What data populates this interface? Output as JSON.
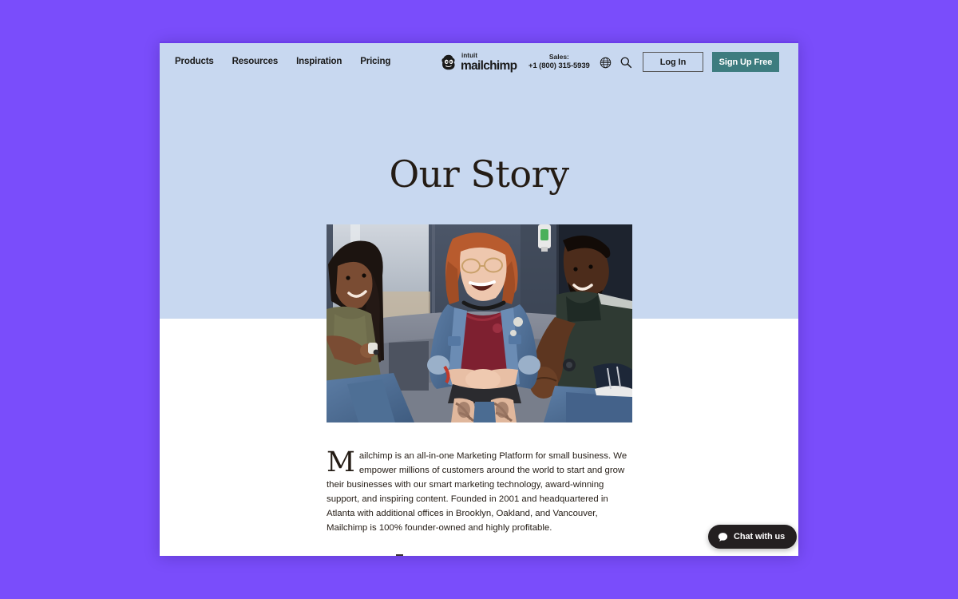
{
  "theme": {
    "page_backdrop": "#7a4dfb",
    "hero_background": "#c8d8f0",
    "accent_teal": "#3d7c7f",
    "text_dark": "#241c15",
    "chat_background": "#231f20"
  },
  "header": {
    "nav_links": [
      {
        "label": "Products",
        "name": "nav-link-products"
      },
      {
        "label": "Resources",
        "name": "nav-link-resources"
      },
      {
        "label": "Inspiration",
        "name": "nav-link-inspiration"
      },
      {
        "label": "Pricing",
        "name": "nav-link-pricing"
      }
    ],
    "brand": {
      "icon": "freddie-monkey-icon",
      "parent": "intuit",
      "name": "mailchimp"
    },
    "sales": {
      "label": "Sales:",
      "phone": "+1 (800) 315-5939"
    },
    "icons": {
      "globe": "globe-icon",
      "search": "search-icon"
    },
    "login_label": "Log In",
    "signup_label": "Sign Up Free"
  },
  "hero": {
    "title": "Our Story",
    "photo_alt": "Three colleagues laughing together on a grey office couch"
  },
  "intro": {
    "dropcap": "M",
    "body": "ailchimp is an all-in-one Marketing Platform for small business. We empower millions of customers around the world to start and grow their businesses with our smart marketing technology, award-winning support, and inspiring content. Founded in 2001 and headquartered in Atlanta with additional offices in Brooklyn, Oakland, and Vancouver, Mailchimp is 100% founder-owned and highly profitable."
  },
  "chat": {
    "label": "Chat with us",
    "icon": "speech-bubble-icon"
  }
}
